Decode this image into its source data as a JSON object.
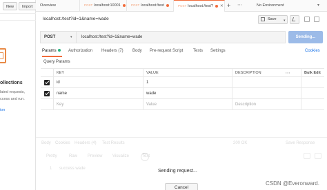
{
  "sidebar": {
    "new_label": "New",
    "import_label": "Import",
    "title_fragment": "ollections",
    "text_line1": "lated requests,",
    "text_line2": "ccess and run.",
    "link_fragment": "ion"
  },
  "tabs": [
    {
      "label": "Overview"
    },
    {
      "method": "POST",
      "label": "localhost:10001"
    },
    {
      "method": "POST",
      "label": "localhost:/test"
    },
    {
      "method": "POST",
      "label": "localhost:/test?"
    }
  ],
  "environment": "No Environment",
  "request": {
    "title": "localhost:/test?id=1&name=wade",
    "save_label": "Save",
    "method": "POST",
    "url": "localhost:/test?id=1&name=wade",
    "send_label": "Sending..."
  },
  "subtabs": [
    "Params",
    "Authorization",
    "Headers (7)",
    "Body",
    "Pre-request Script",
    "Tests",
    "Settings"
  ],
  "cookies_label": "Cookies",
  "query_params_label": "Query Params",
  "table": {
    "headers": [
      "KEY",
      "VALUE",
      "DESCRIPTION"
    ],
    "bulk_edit": "Bulk Edit",
    "rows": [
      {
        "key": "id",
        "value": "1",
        "description": ""
      },
      {
        "key": "name",
        "value": "wade",
        "description": ""
      }
    ],
    "placeholder": {
      "key": "Key",
      "value": "Value",
      "description": "Description"
    }
  },
  "response": {
    "tabs": [
      "Body",
      "Cookies",
      "Headers (4)",
      "Test Results"
    ],
    "status": "200 OK",
    "save_response": "Save Response",
    "view_modes": [
      "Pretty",
      "Raw",
      "Preview",
      "Visualize"
    ],
    "format": "Text",
    "line_number": "1",
    "body_line": "success wade",
    "sending_text": "Sending request...",
    "cancel_label": "Cancel"
  },
  "watermark": "CSDN @Everonward.",
  "colors": {
    "accent": "#f26b3a",
    "send_button": "#9cbbe8",
    "link": "#1a73e8",
    "params_dot": "#26b47f"
  }
}
